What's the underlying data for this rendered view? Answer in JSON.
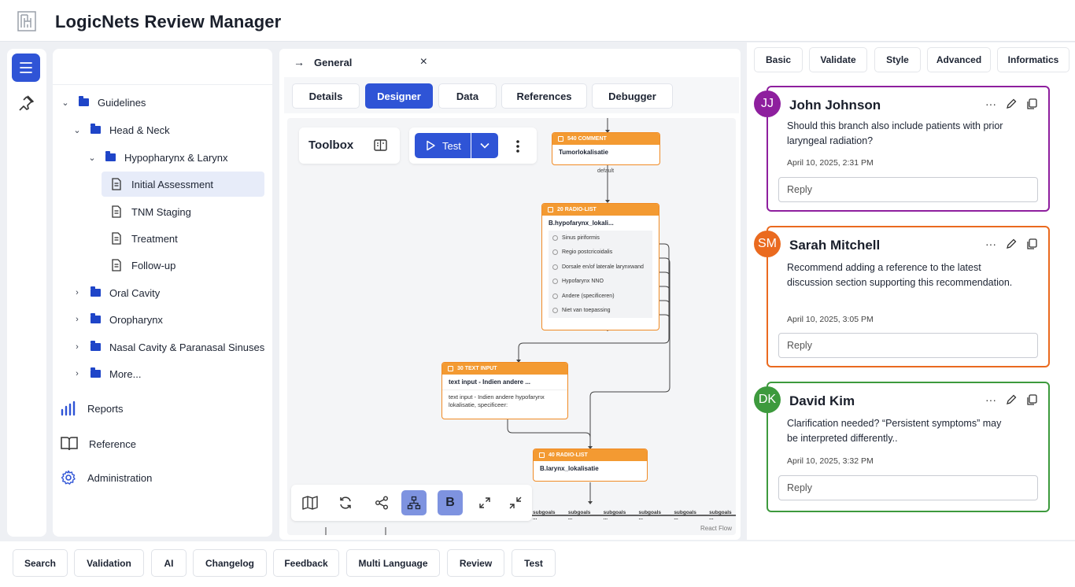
{
  "app": {
    "title": "LogicNets Review Manager"
  },
  "sidebar": {
    "tree": [
      {
        "label": "Guidelines",
        "chev": "⌄"
      },
      {
        "label": "Head & Neck",
        "chev": "⌄"
      },
      {
        "label": "Hypopharynx & Larynx",
        "chev": "⌄"
      },
      {
        "label": "Initial Assessment"
      },
      {
        "label": "TNM Staging"
      },
      {
        "label": "Treatment"
      },
      {
        "label": "Follow-up"
      },
      {
        "label": "Oral Cavity",
        "chev": "›"
      },
      {
        "label": "Oropharynx",
        "chev": "›"
      },
      {
        "label": "Nasal Cavity & Paranasal Sinuses",
        "chev": "›"
      },
      {
        "label": "More...",
        "chev": "›"
      }
    ],
    "nav": [
      {
        "label": "Reports"
      },
      {
        "label": "Reference"
      },
      {
        "label": "Administration"
      }
    ]
  },
  "editor": {
    "tab_label": "General",
    "tab_close": "×",
    "tabs": [
      "Details",
      "Designer",
      "Data",
      "References",
      "Debugger"
    ],
    "toolbox_label": "Toolbox",
    "test_label": "Test",
    "canvas_attribution": "React Flow",
    "edge_label": "default",
    "subgoals": [
      "subgoals ...",
      "subgoals ...",
      "subgoals ...",
      "subgoals ...",
      "subgoals ...",
      "subgoals ..."
    ],
    "nodes": {
      "n540": {
        "type": "540 COMMENT",
        "title": "Tumorlokalisatie"
      },
      "n20": {
        "type": "20 RADIO-LIST",
        "title": "B.hypofarynx_lokali...",
        "options": [
          "Sinus piriformis",
          "Regio postcricoidalis",
          "Dorsale en/of laterale larynxwand",
          "Hypofarynx NNO",
          "Andere (specificeren)",
          "Niet van toepassing"
        ]
      },
      "n30": {
        "type": "30 TEXT INPUT",
        "title": "text input - Indien andere ...",
        "body": "text input - Indien andere hypofarynx lokalisatie, specificeer:"
      },
      "n40": {
        "type": "40 RADIO-LIST",
        "title": "B.larynx_lokalisatie"
      }
    },
    "bottom_tools": {
      "bold_label": "B"
    }
  },
  "review": {
    "tabs": [
      "Basic",
      "Validate",
      "Style",
      "Advanced",
      "Informatics"
    ],
    "comments": [
      {
        "initials": "JJ",
        "name": "John Johnson",
        "text": "Should this branch also include patients with prior laryngeal radiation?",
        "date": "April 10, 2025, 2:31 PM",
        "reply_placeholder": "Reply",
        "color": "#8e1f9e"
      },
      {
        "initials": "SM",
        "name": "Sarah Mitchell",
        "text": "Recommend adding a reference to the latest discussion section supporting this recommendation.",
        "date": "April 10, 2025, 3:05 PM",
        "reply_placeholder": "Reply",
        "color": "#ea6a1f"
      },
      {
        "initials": "DK",
        "name": "David Kim",
        "text": "Clarification needed?  “Persistent symptoms” may be interpreted differently..",
        "date": "April 10, 2025, 3:32 PM",
        "reply_placeholder": "Reply",
        "color": "#3d9a3d"
      }
    ],
    "more_label": "···"
  },
  "footer": {
    "buttons": [
      "Search",
      "Validation",
      "AI",
      "Changelog",
      "Feedback",
      "Multi Language",
      "Review",
      "Test"
    ]
  },
  "colors": {
    "accent": "#2f54d6",
    "node_orange": "#f39a32"
  }
}
